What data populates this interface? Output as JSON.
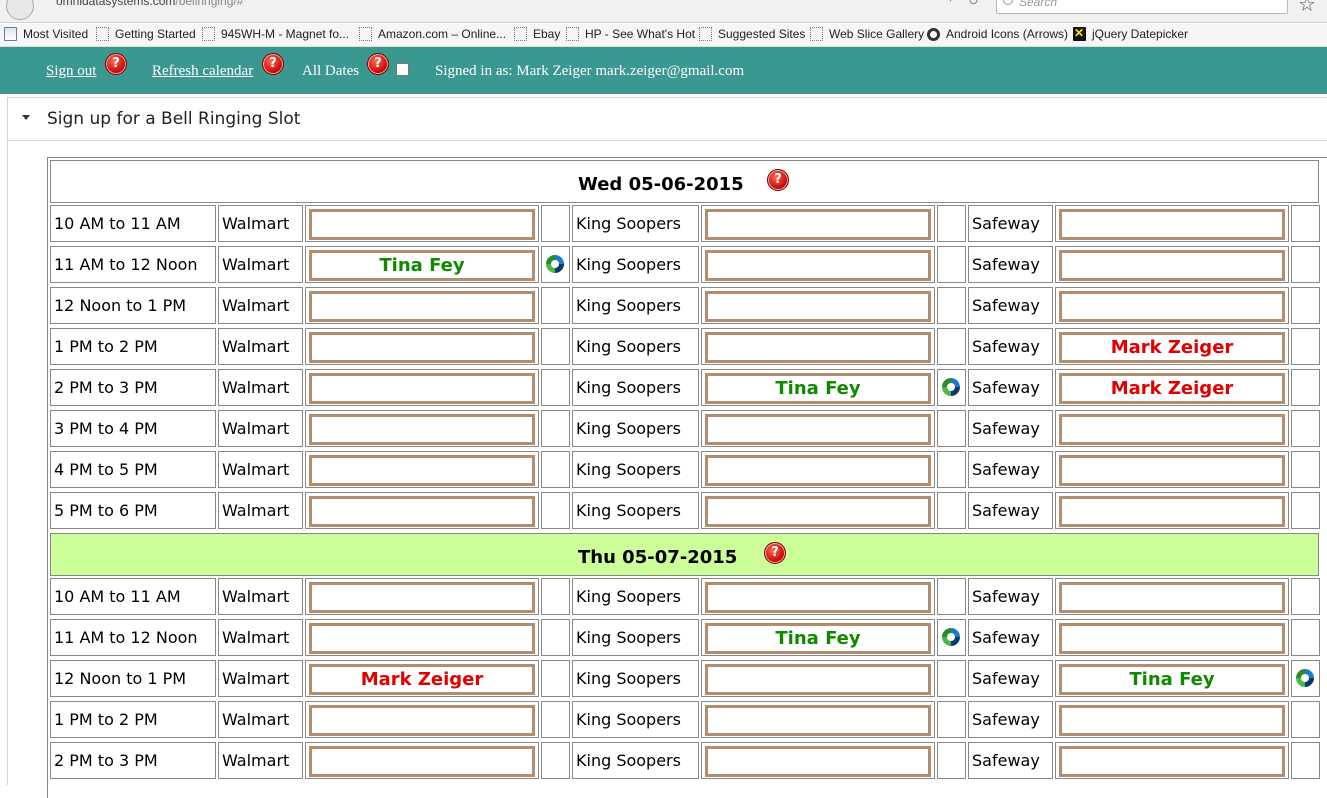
{
  "browser": {
    "url_host": "omnidatasystems.com",
    "url_path": "/bellringing/#",
    "search_placeholder": "Search",
    "bookmarks": [
      {
        "label": "Most Visited",
        "icon": "page-icon"
      },
      {
        "label": "Getting Started",
        "icon": "dotted-page-icon"
      },
      {
        "label": "945WH-M - Magnet fo...",
        "icon": "dotted-page-icon"
      },
      {
        "label": "Amazon.com – Online...",
        "icon": "dotted-page-icon"
      },
      {
        "label": "Ebay",
        "icon": "dotted-page-icon"
      },
      {
        "label": "HP - See What's Hot",
        "icon": "dotted-page-icon"
      },
      {
        "label": "Suggested Sites",
        "icon": "dotted-page-icon"
      },
      {
        "label": "Web Slice Gallery",
        "icon": "dotted-page-icon"
      },
      {
        "label": "Android Icons (Arrows)",
        "icon": "android-icon"
      },
      {
        "label": "jQuery Datepicker",
        "icon": "jquery-icon"
      }
    ]
  },
  "appbar": {
    "sign_out": "Sign out",
    "refresh": "Refresh calendar",
    "all_dates": "All Dates",
    "signed_in": "Signed in as: Mark Zeiger mark.zeiger@gmail.com",
    "all_dates_checked": false,
    "background_color": "#3a9891"
  },
  "panel": {
    "title": "Sign up for a Bell Ringing Slot"
  },
  "help_glyph": "?",
  "stores": [
    "Walmart",
    "King Soopers",
    "Safeway"
  ],
  "days": [
    {
      "date": "Wed 05-06-2015",
      "highlight": false,
      "slots": [
        {
          "time": "10 AM to 11 AM",
          "walmart": "",
          "king_soopers": "",
          "safeway": ""
        },
        {
          "time": "11 AM to 12 Noon",
          "walmart": "Tina Fey",
          "king_soopers": "",
          "safeway": ""
        },
        {
          "time": "12 Noon to 1 PM",
          "walmart": "",
          "king_soopers": "",
          "safeway": ""
        },
        {
          "time": "1 PM to 2 PM",
          "walmart": "",
          "king_soopers": "",
          "safeway": "Mark Zeiger"
        },
        {
          "time": "2 PM to 3 PM",
          "walmart": "",
          "king_soopers": "Tina Fey",
          "safeway": "Mark Zeiger"
        },
        {
          "time": "3 PM to 4 PM",
          "walmart": "",
          "king_soopers": "",
          "safeway": ""
        },
        {
          "time": "4 PM to 5 PM",
          "walmart": "",
          "king_soopers": "",
          "safeway": ""
        },
        {
          "time": "5 PM to 6 PM",
          "walmart": "",
          "king_soopers": "",
          "safeway": ""
        }
      ]
    },
    {
      "date": "Thu 05-07-2015",
      "highlight": true,
      "slots": [
        {
          "time": "10 AM to 11 AM",
          "walmart": "",
          "king_soopers": "",
          "safeway": ""
        },
        {
          "time": "11 AM to 12 Noon",
          "walmart": "",
          "king_soopers": "Tina Fey",
          "safeway": ""
        },
        {
          "time": "12 Noon to 1 PM",
          "walmart": "Mark Zeiger",
          "king_soopers": "",
          "safeway": "Tina Fey"
        },
        {
          "time": "1 PM to 2 PM",
          "walmart": "",
          "king_soopers": "",
          "safeway": ""
        },
        {
          "time": "2 PM to 3 PM",
          "walmart": "",
          "king_soopers": "",
          "safeway": ""
        }
      ]
    }
  ],
  "current_user": "Mark Zeiger",
  "colors": {
    "own_signup": "#e00000",
    "other_signup": "#0f8a00",
    "slot_border": "#b38e6e",
    "day_highlight": "#ccff99"
  }
}
